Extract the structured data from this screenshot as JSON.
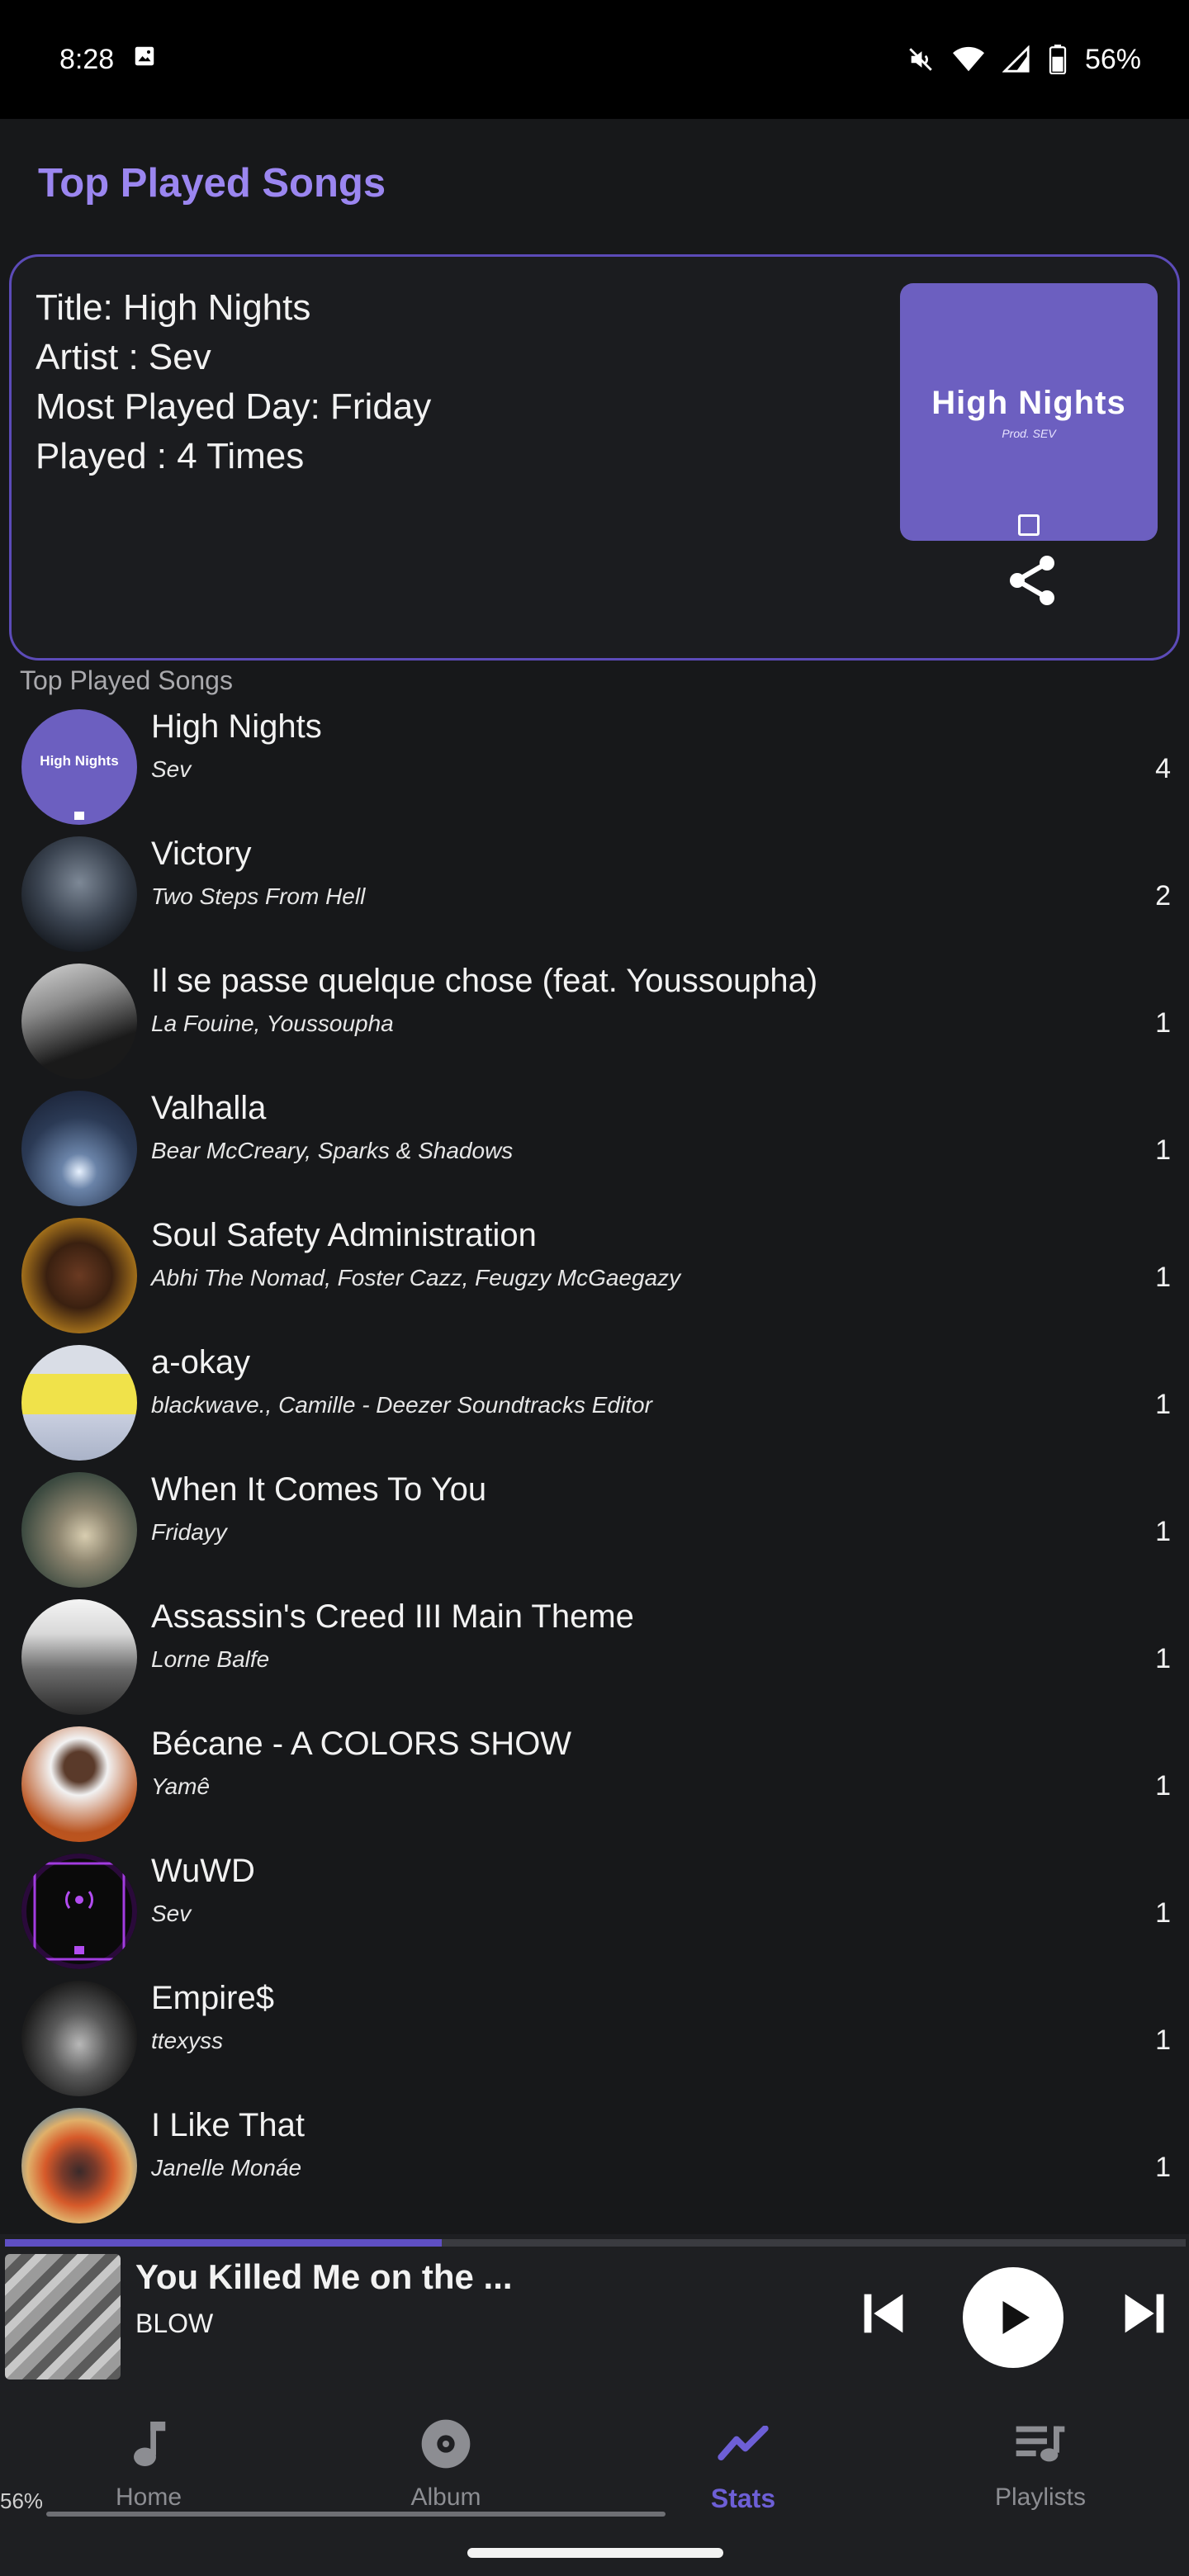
{
  "status_bar": {
    "time": "8:28",
    "battery_text": "56%",
    "icons": [
      "image-icon",
      "mute-icon",
      "wifi-icon",
      "signal-icon",
      "battery-icon"
    ]
  },
  "page": {
    "title": "Top Played Songs"
  },
  "featured": {
    "title_line": "Title: High Nights",
    "artist_line": "Artist : Sev",
    "day_line": "Most Played Day: Friday",
    "played_line": "Played : 4 Times",
    "art_title": "High Nights",
    "art_subtitle": "Prod. SEV",
    "art_color": "#6c5fc0"
  },
  "list": {
    "section_label": "Top Played Songs",
    "songs": [
      {
        "title": "High Nights",
        "artist": "Sev",
        "count": "4"
      },
      {
        "title": "Victory",
        "artist": "Two Steps From Hell",
        "count": "2"
      },
      {
        "title": "Il se passe quelque chose (feat. Youssoupha)",
        "artist": "La Fouine, Youssoupha",
        "count": "1"
      },
      {
        "title": "Valhalla",
        "artist": "Bear McCreary, Sparks & Shadows",
        "count": "1"
      },
      {
        "title": "Soul Safety Administration",
        "artist": "Abhi The Nomad, Foster Cazz, Feugzy McGaegazy",
        "count": "1"
      },
      {
        "title": "a-okay",
        "artist": "blackwave., Camille - Deezer Soundtracks Editor",
        "count": "1"
      },
      {
        "title": "When It Comes To You",
        "artist": "Fridayy",
        "count": "1"
      },
      {
        "title": "Assassin's Creed III Main Theme",
        "artist": "Lorne Balfe",
        "count": "1"
      },
      {
        "title": "Bécane - A COLORS SHOW",
        "artist": "Yamê",
        "count": "1"
      },
      {
        "title": "WuWD",
        "artist": "Sev",
        "count": "1"
      },
      {
        "title": "Empire$",
        "artist": "ttexyss",
        "count": "1"
      },
      {
        "title": "I Like That",
        "artist": "Janelle Monáe",
        "count": "1"
      }
    ]
  },
  "player": {
    "title": "You Killed Me on the ...",
    "artist": "BLOW",
    "progress": 0.37
  },
  "nav": {
    "items": [
      {
        "label": "Home",
        "icon": "music-note-icon"
      },
      {
        "label": "Album",
        "icon": "disc-icon"
      },
      {
        "label": "Stats",
        "icon": "trend-icon"
      },
      {
        "label": "Playlists",
        "icon": "playlist-icon"
      }
    ],
    "active": "Stats",
    "percent_text": "56%"
  },
  "colors": {
    "accent": "#6d5fd6",
    "title_accent": "#9b86f0",
    "background": "#17181a"
  }
}
